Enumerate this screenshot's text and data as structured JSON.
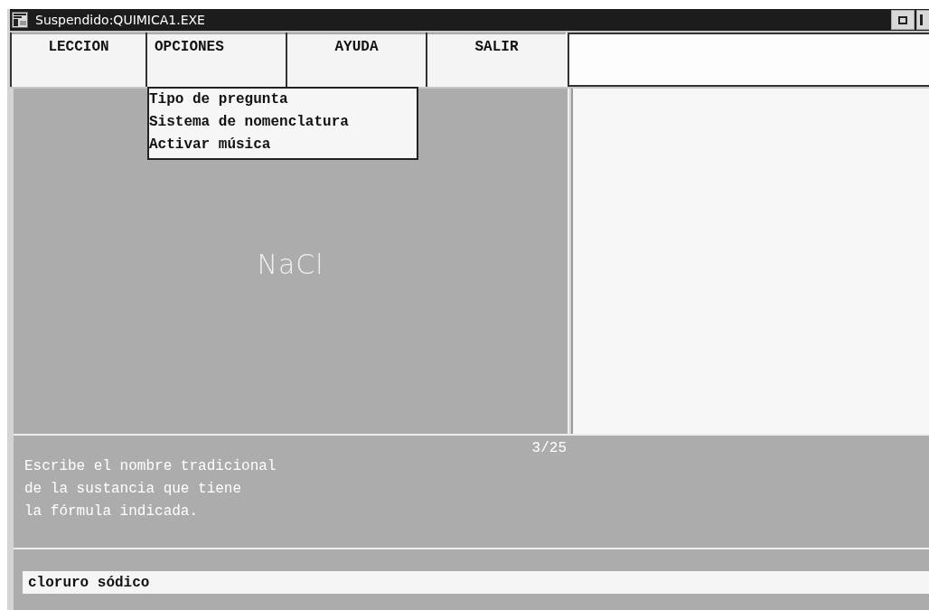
{
  "window": {
    "title": "Suspendido:QUIMICA1.EXE"
  },
  "menu": [
    {
      "label": "LECCION",
      "expanded": false
    },
    {
      "label": "OPCIONES",
      "expanded": true,
      "items": [
        "Tipo de pregunta",
        "Sistema de nomenclatura",
        "Activar música"
      ]
    },
    {
      "label": "AYUDA",
      "expanded": false
    },
    {
      "label": "SALIR",
      "expanded": false
    }
  ],
  "formula": "NaCl",
  "counter": "3/25",
  "question": [
    "Escribe el nombre tradicional",
    "de la sustancia que tiene",
    "la fórmula indicada."
  ],
  "answer": {
    "value": "cloruro sódico"
  }
}
